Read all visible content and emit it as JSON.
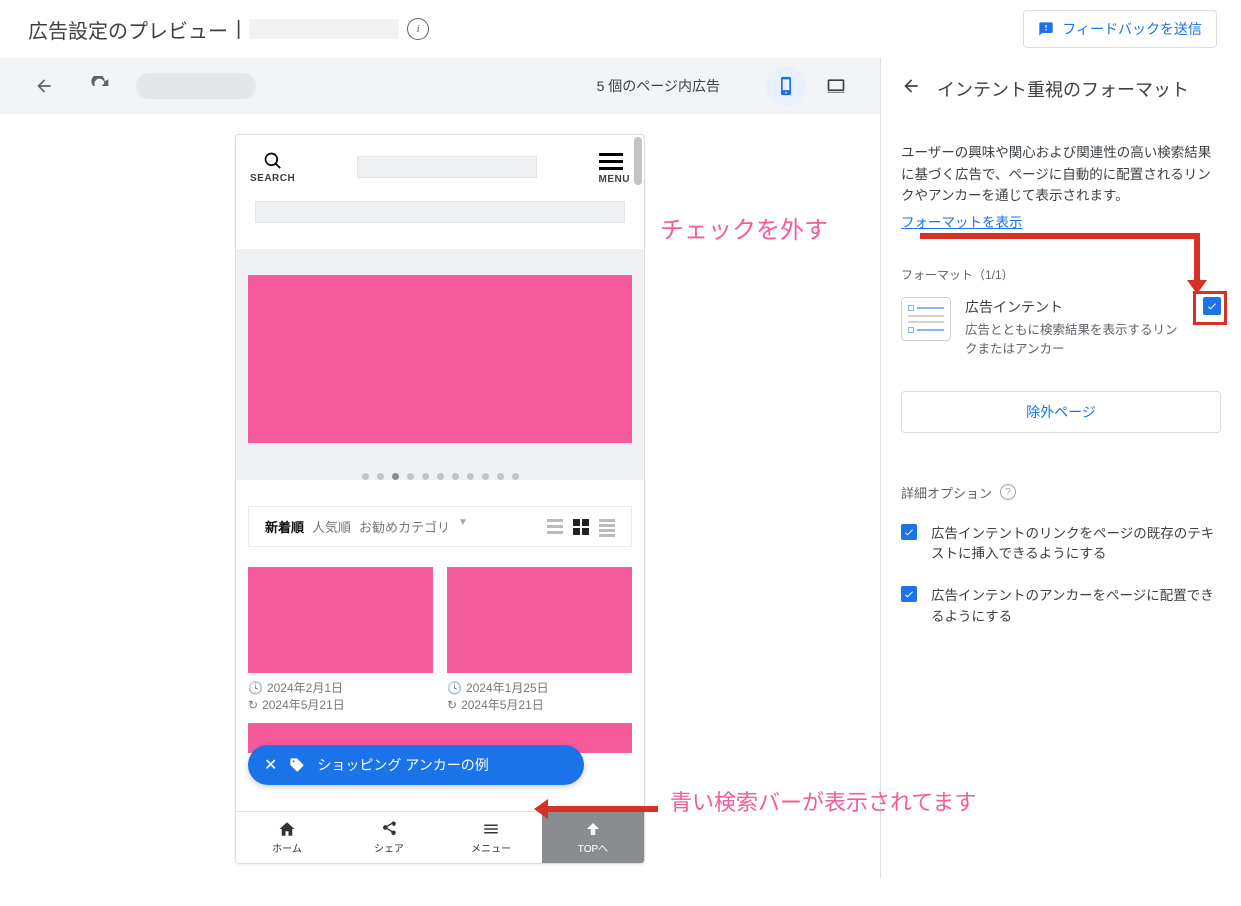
{
  "header": {
    "title": "広告設定のプレビュー",
    "feedback": "フィードバックを送信"
  },
  "toolbar": {
    "ad_count": "5 個のページ内広告"
  },
  "mobile": {
    "search_label": "SEARCH",
    "menu_label": "MENU",
    "sort": {
      "newest": "新着順",
      "popular": "人気順",
      "recommended": "お勧めカテゴリ"
    },
    "card1": {
      "date": "2024年2月1日",
      "updated": "2024年5月21日"
    },
    "card2": {
      "date": "2024年1月25日",
      "updated": "2024年5月21日"
    },
    "anchor": "ショッピング アンカーの例",
    "nav": {
      "home": "ホーム",
      "share": "シェア",
      "menu": "メニュー",
      "top": "TOPへ"
    }
  },
  "right": {
    "title": "インテント重視のフォーマット",
    "desc": "ユーザーの興味や関心および関連性の高い検索結果に基づく広告で、ページに自動的に配置されるリンクやアンカーを通じて表示されます。",
    "show_format": "フォーマットを表示",
    "format_header": "フォーマット（1/1）",
    "format_name": "広告インテント",
    "format_sub": "広告とともに検索結果を表示するリンクまたはアンカー",
    "exclude": "除外ページ",
    "advanced": "詳細オプション",
    "opt1": "広告インテントのリンクをページの既存のテキストに挿入できるようにする",
    "opt2": "広告インテントのアンカーをページに配置できるようにする"
  },
  "annotations": {
    "uncheck": "チェックを外す",
    "blue_bar": "青い検索バーが表示されてます"
  }
}
